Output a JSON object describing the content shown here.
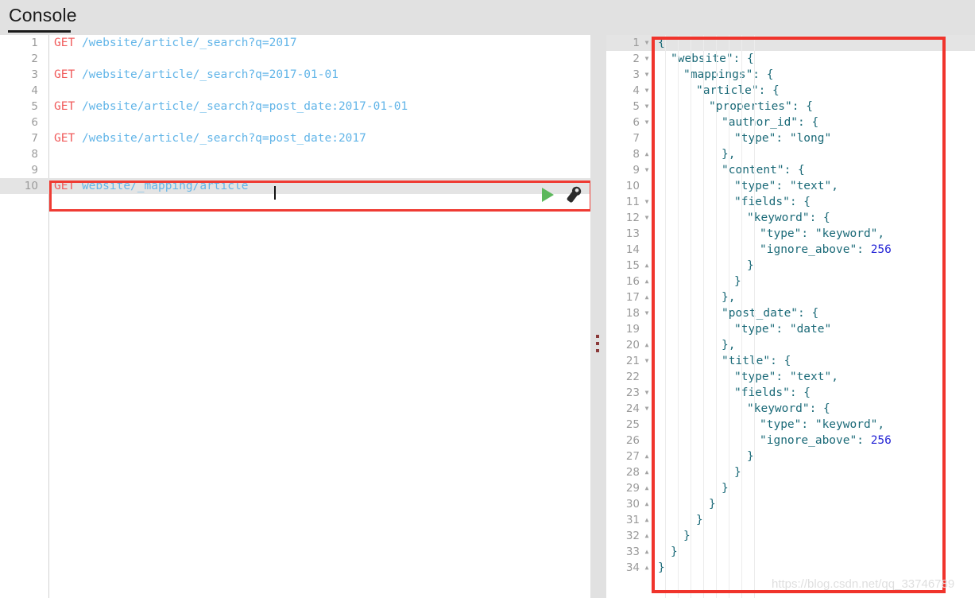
{
  "app": {
    "title": "Console",
    "watermark": "https://blog.csdn.net/qq_33746789"
  },
  "colors": {
    "header_bg": "#e1e1e1",
    "accent_red_box": "#ef3b33",
    "method_keyword": "#f05a5a",
    "url_text": "#62b5e8",
    "json_text": "#1b6a78",
    "json_number": "#2626d6",
    "run_button_green": "#5cb85c",
    "active_line_bg": "#e4e4e4"
  },
  "editor": {
    "name": "request-editor",
    "active_line": 10,
    "cursor_line": 10,
    "lines": [
      {
        "n": 1,
        "method": "GET",
        "url": "/website/article/_search?q=2017"
      },
      {
        "n": 2,
        "method": "",
        "url": ""
      },
      {
        "n": 3,
        "method": "GET",
        "url": "/website/article/_search?q=2017-01-01"
      },
      {
        "n": 4,
        "method": "",
        "url": ""
      },
      {
        "n": 5,
        "method": "GET",
        "url": "/website/article/_search?q=post_date:2017-01-01"
      },
      {
        "n": 6,
        "method": "",
        "url": ""
      },
      {
        "n": 7,
        "method": "GET",
        "url": "/website/article/_search?q=post_date:2017"
      },
      {
        "n": 8,
        "method": "",
        "url": ""
      },
      {
        "n": 9,
        "method": "",
        "url": ""
      },
      {
        "n": 10,
        "method": "GET",
        "url": "website/_mapping/article"
      }
    ]
  },
  "actions": {
    "run_label": "play-icon",
    "settings_label": "wrench-icon"
  },
  "response": {
    "name": "response-viewer",
    "active_line": 1,
    "lines": [
      {
        "n": 1,
        "fold": "down",
        "indent": 0,
        "text": "{"
      },
      {
        "n": 2,
        "fold": "down",
        "indent": 1,
        "text": "\"website\": {"
      },
      {
        "n": 3,
        "fold": "down",
        "indent": 2,
        "text": "\"mappings\": {"
      },
      {
        "n": 4,
        "fold": "down",
        "indent": 3,
        "text": "\"article\": {"
      },
      {
        "n": 5,
        "fold": "down",
        "indent": 4,
        "text": "\"properties\": {"
      },
      {
        "n": 6,
        "fold": "down",
        "indent": 5,
        "text": "\"author_id\": {"
      },
      {
        "n": 7,
        "fold": "",
        "indent": 6,
        "text": "\"type\": \"long\""
      },
      {
        "n": 8,
        "fold": "up",
        "indent": 5,
        "text": "},"
      },
      {
        "n": 9,
        "fold": "down",
        "indent": 5,
        "text": "\"content\": {"
      },
      {
        "n": 10,
        "fold": "",
        "indent": 6,
        "text": "\"type\": \"text\","
      },
      {
        "n": 11,
        "fold": "down",
        "indent": 6,
        "text": "\"fields\": {"
      },
      {
        "n": 12,
        "fold": "down",
        "indent": 7,
        "text": "\"keyword\": {"
      },
      {
        "n": 13,
        "fold": "",
        "indent": 8,
        "text": "\"type\": \"keyword\","
      },
      {
        "n": 14,
        "fold": "",
        "indent": 8,
        "text": "\"ignore_above\": 256",
        "num": "256"
      },
      {
        "n": 15,
        "fold": "up",
        "indent": 7,
        "text": "}"
      },
      {
        "n": 16,
        "fold": "up",
        "indent": 6,
        "text": "}"
      },
      {
        "n": 17,
        "fold": "up",
        "indent": 5,
        "text": "},"
      },
      {
        "n": 18,
        "fold": "down",
        "indent": 5,
        "text": "\"post_date\": {"
      },
      {
        "n": 19,
        "fold": "",
        "indent": 6,
        "text": "\"type\": \"date\""
      },
      {
        "n": 20,
        "fold": "up",
        "indent": 5,
        "text": "},"
      },
      {
        "n": 21,
        "fold": "down",
        "indent": 5,
        "text": "\"title\": {"
      },
      {
        "n": 22,
        "fold": "",
        "indent": 6,
        "text": "\"type\": \"text\","
      },
      {
        "n": 23,
        "fold": "down",
        "indent": 6,
        "text": "\"fields\": {"
      },
      {
        "n": 24,
        "fold": "down",
        "indent": 7,
        "text": "\"keyword\": {"
      },
      {
        "n": 25,
        "fold": "",
        "indent": 8,
        "text": "\"type\": \"keyword\","
      },
      {
        "n": 26,
        "fold": "",
        "indent": 8,
        "text": "\"ignore_above\": 256",
        "num": "256"
      },
      {
        "n": 27,
        "fold": "up",
        "indent": 7,
        "text": "}"
      },
      {
        "n": 28,
        "fold": "up",
        "indent": 6,
        "text": "}"
      },
      {
        "n": 29,
        "fold": "up",
        "indent": 5,
        "text": "}"
      },
      {
        "n": 30,
        "fold": "up",
        "indent": 4,
        "text": "}"
      },
      {
        "n": 31,
        "fold": "up",
        "indent": 3,
        "text": "}"
      },
      {
        "n": 32,
        "fold": "up",
        "indent": 2,
        "text": "}"
      },
      {
        "n": 33,
        "fold": "up",
        "indent": 1,
        "text": "}"
      },
      {
        "n": 34,
        "fold": "up",
        "indent": 0,
        "text": "}"
      }
    ]
  },
  "splitter": {
    "name": "pane-splitter",
    "dots": 3
  }
}
